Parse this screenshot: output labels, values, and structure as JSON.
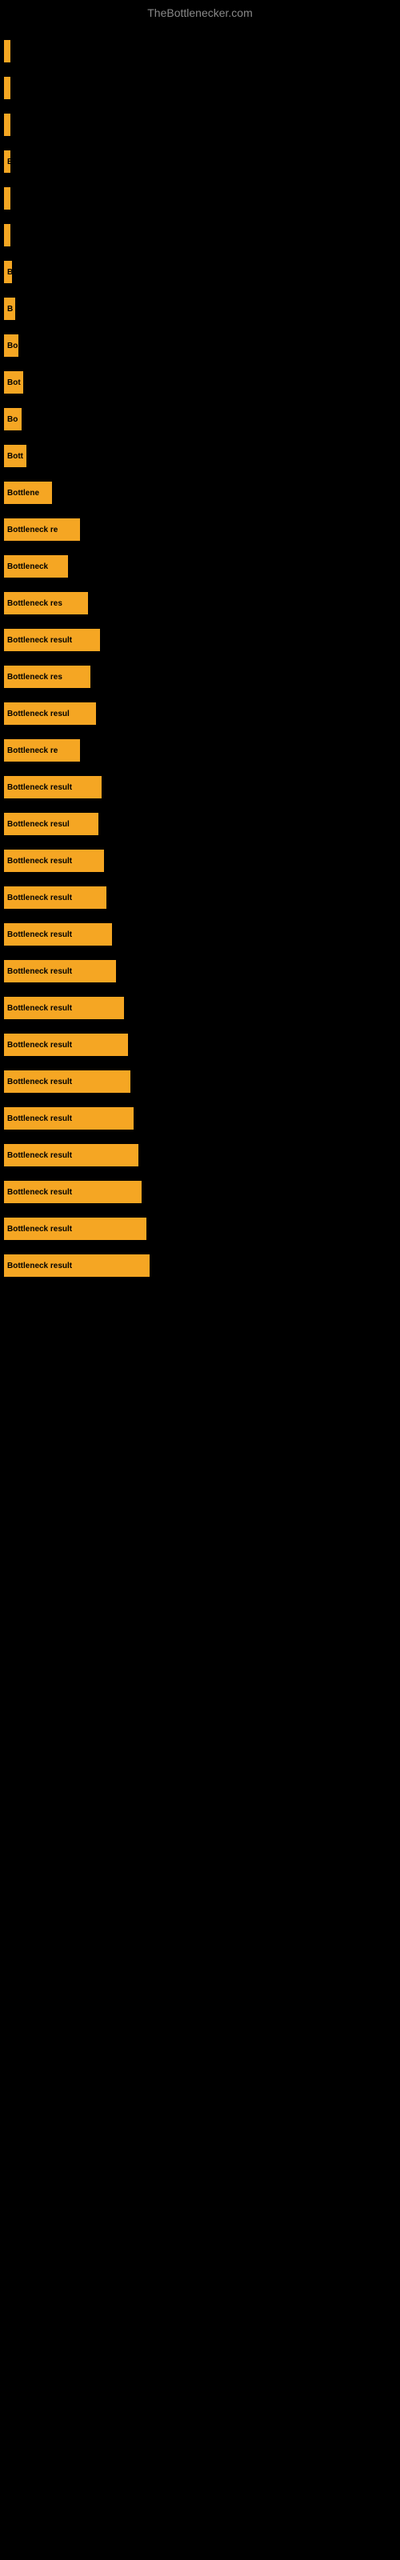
{
  "site": {
    "title": "TheBottlenecker.com"
  },
  "bars": [
    {
      "label": "",
      "width": 4
    },
    {
      "label": "",
      "width": 6
    },
    {
      "label": "",
      "width": 6
    },
    {
      "label": "B",
      "width": 8
    },
    {
      "label": "",
      "width": 6
    },
    {
      "label": "",
      "width": 6
    },
    {
      "label": "B",
      "width": 10
    },
    {
      "label": "B",
      "width": 14
    },
    {
      "label": "Bo",
      "width": 18
    },
    {
      "label": "Bot",
      "width": 24
    },
    {
      "label": "Bo",
      "width": 22
    },
    {
      "label": "Bott",
      "width": 28
    },
    {
      "label": "Bottlene",
      "width": 60
    },
    {
      "label": "Bottleneck re",
      "width": 95
    },
    {
      "label": "Bottleneck",
      "width": 80
    },
    {
      "label": "Bottleneck res",
      "width": 105
    },
    {
      "label": "Bottleneck result",
      "width": 120
    },
    {
      "label": "Bottleneck res",
      "width": 108
    },
    {
      "label": "Bottleneck resul",
      "width": 115
    },
    {
      "label": "Bottleneck re",
      "width": 95
    },
    {
      "label": "Bottleneck result",
      "width": 122
    },
    {
      "label": "Bottleneck resul",
      "width": 118
    },
    {
      "label": "Bottleneck result",
      "width": 125
    },
    {
      "label": "Bottleneck result",
      "width": 128
    },
    {
      "label": "Bottleneck result",
      "width": 135
    },
    {
      "label": "Bottleneck result",
      "width": 140
    },
    {
      "label": "Bottleneck result",
      "width": 150
    },
    {
      "label": "Bottleneck result",
      "width": 155
    },
    {
      "label": "Bottleneck result",
      "width": 158
    },
    {
      "label": "Bottleneck result",
      "width": 162
    },
    {
      "label": "Bottleneck result",
      "width": 168
    },
    {
      "label": "Bottleneck result",
      "width": 172
    },
    {
      "label": "Bottleneck result",
      "width": 178
    },
    {
      "label": "Bottleneck result",
      "width": 182
    }
  ]
}
